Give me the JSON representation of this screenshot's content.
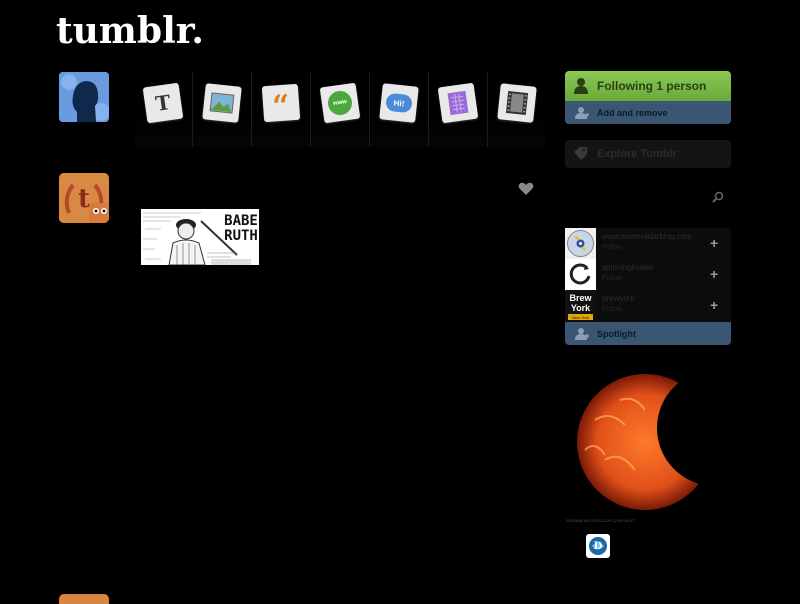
{
  "header": {
    "logo_text": "tumblr."
  },
  "post_types": [
    {
      "name": "text",
      "glyph": "T"
    },
    {
      "name": "photo",
      "glyph": ""
    },
    {
      "name": "quote",
      "glyph": "“"
    },
    {
      "name": "link",
      "glyph": "www"
    },
    {
      "name": "chat",
      "glyph": "Hi!"
    },
    {
      "name": "audio",
      "glyph": ""
    },
    {
      "name": "video",
      "glyph": ""
    }
  ],
  "post": {
    "image_caption_lines": [
      "BABE",
      "RUTH"
    ]
  },
  "sidebar": {
    "following_label": "Following 1 person",
    "add_remove_label": "Add and remove",
    "explore_label": "Explore Tumblr",
    "radar": [
      {
        "name": "www.someradarblog.com",
        "sub": "Follow",
        "thumb": "cd"
      },
      {
        "name": "spinningloader",
        "sub": "Follow",
        "thumb": "loader"
      },
      {
        "name": "brewyork",
        "sub": "Follow",
        "thumb": "brew",
        "thumb_lines": [
          "Brew",
          "York",
          "New York"
        ]
      }
    ],
    "spotlight_label": "Spotlight",
    "sun_caption": "SDO/AIA 304   2012-02-29  12:00:44 UT"
  },
  "colors": {
    "following_green": "#7ab947",
    "nav_blue": "#3a5673",
    "sun_orange": "#e0501a"
  }
}
